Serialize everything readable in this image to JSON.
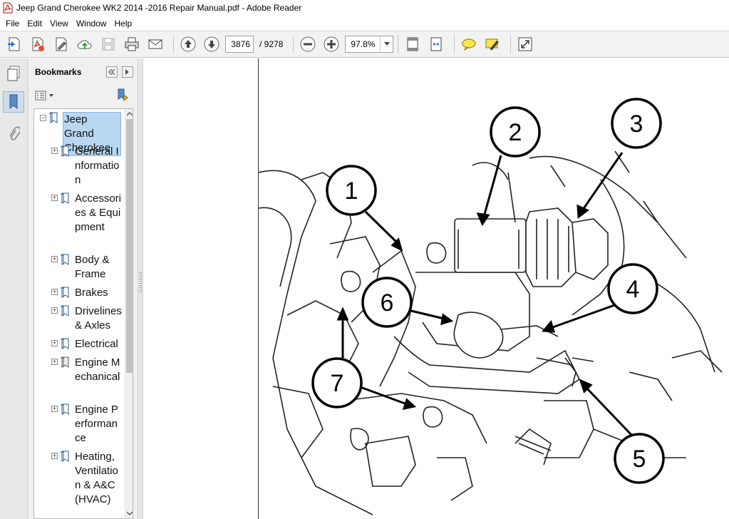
{
  "window": {
    "title": "Jeep Grand Cherokee WK2 2014 -2016 Repair Manual.pdf - Adobe Reader"
  },
  "menu": [
    "File",
    "Edit",
    "View",
    "Window",
    "Help"
  ],
  "toolbar": {
    "page_current": "3876",
    "page_total": "/ 9278",
    "zoom": "97.8%",
    "icons": [
      "create-pdf-icon",
      "export-pdf-icon",
      "edit-icon",
      "cloud-upload-icon",
      "save-icon",
      "print-icon",
      "email-icon",
      "previous-page-icon",
      "next-page-icon",
      "zoom-out-icon",
      "zoom-in-icon",
      "fit-page-icon",
      "fit-width-icon",
      "comment-icon",
      "highlight-icon",
      "fullscreen-icon"
    ]
  },
  "bookmarks_panel": {
    "title": "Bookmarks",
    "items": [
      {
        "label": "Jeep Grand Cherokee",
        "level": 0,
        "expand": "−",
        "selected": true
      },
      {
        "label": "General Information",
        "level": 1,
        "expand": "+"
      },
      {
        "label": "Accessories & Equipment",
        "level": 1,
        "expand": "+"
      },
      {
        "label": "Body & Frame",
        "level": 1,
        "expand": "+"
      },
      {
        "label": "Brakes",
        "level": 1,
        "expand": "+"
      },
      {
        "label": "Drivelines & Axles",
        "level": 1,
        "expand": "+"
      },
      {
        "label": "Electrical",
        "level": 1,
        "expand": "+"
      },
      {
        "label": "Engine Mechanical",
        "level": 1,
        "expand": "+"
      },
      {
        "label": "Engine Performance",
        "level": 1,
        "expand": "+"
      },
      {
        "label": "Heating, Ventilation & A&C (HVAC)",
        "level": 1,
        "expand": "+"
      }
    ]
  },
  "figure": {
    "callouts": [
      "1",
      "2",
      "3",
      "4",
      "5",
      "6",
      "7"
    ]
  }
}
